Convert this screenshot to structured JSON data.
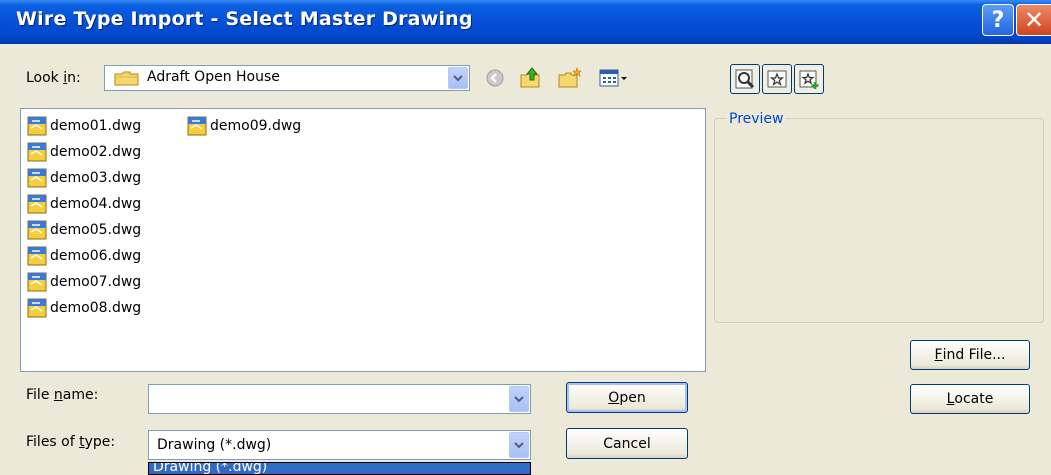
{
  "window": {
    "title": "Wire Type Import - Select Master Drawing",
    "help_button": "?",
    "close_button": "✕"
  },
  "toolbar": {
    "look_in_label_pre": "Look ",
    "look_in_label_acc": "i",
    "look_in_label_post": "n:",
    "look_in_value": "Adraft Open House",
    "icons": [
      "back-icon",
      "up-folder-icon",
      "new-folder-icon",
      "view-menu-icon"
    ]
  },
  "preview_toolbar": {
    "icons": [
      "zoom-preview-icon",
      "favorites-icon",
      "add-favorite-icon"
    ]
  },
  "files": [
    {
      "name": "demo01.dwg"
    },
    {
      "name": "demo02.dwg"
    },
    {
      "name": "demo03.dwg"
    },
    {
      "name": "demo04.dwg"
    },
    {
      "name": "demo05.dwg"
    },
    {
      "name": "demo06.dwg"
    },
    {
      "name": "demo07.dwg"
    },
    {
      "name": "demo08.dwg"
    },
    {
      "name": "demo09.dwg"
    }
  ],
  "preview": {
    "label": "Preview"
  },
  "form": {
    "file_name_label_pre": "File ",
    "file_name_label_acc": "n",
    "file_name_label_post": "ame:",
    "file_name_value": "",
    "files_of_type_label_pre": "Files of ",
    "files_of_type_label_acc": "t",
    "files_of_type_label_post": "ype:",
    "files_of_type_value": "Drawing (*.dwg)",
    "dropdown_selected": "Drawing (*.dwg)"
  },
  "buttons": {
    "open_acc": "O",
    "open_rest": "pen",
    "cancel": "Cancel",
    "find_file_acc": "F",
    "find_file_rest": "ind File...",
    "locate_acc": "L",
    "locate_rest": "ocate"
  },
  "colors": {
    "titlebar": "#0650d8",
    "dialog_bg": "#ece9d8",
    "selection": "#316ac5",
    "preview_label": "#0046d5"
  }
}
